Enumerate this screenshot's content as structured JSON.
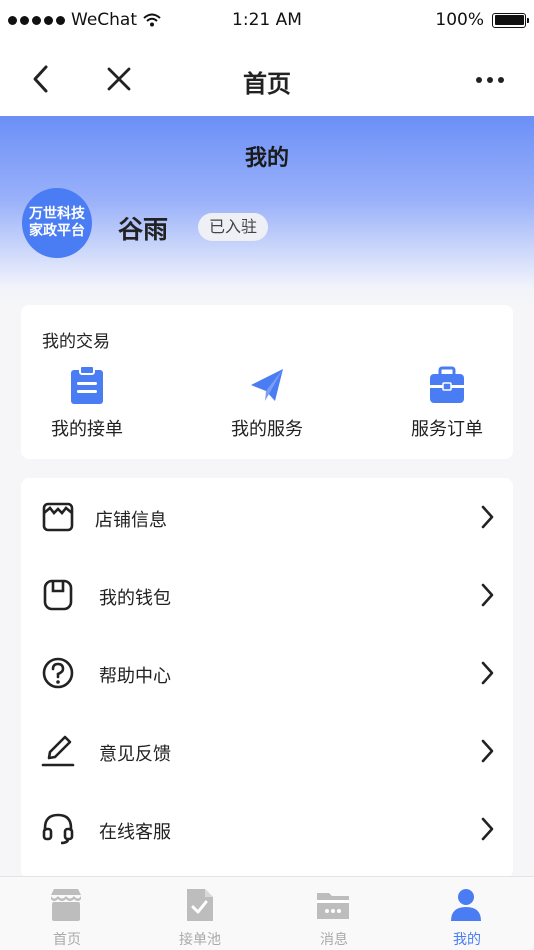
{
  "status_bar": {
    "carrier": "WeChat",
    "time": "1:21 AM",
    "battery": "100%"
  },
  "nav": {
    "title": "首页"
  },
  "hero": {
    "title": "我的",
    "avatar_line1": "万世科技",
    "avatar_line2": "家政平台",
    "user_name": "谷雨",
    "badge": "已入驻"
  },
  "trade": {
    "title": "我的交易",
    "items": [
      {
        "label": "我的接单",
        "icon": "clipboard-icon"
      },
      {
        "label": "我的服务",
        "icon": "paper-plane-icon"
      },
      {
        "label": "服务订单",
        "icon": "briefcase-icon"
      }
    ]
  },
  "menu": {
    "items": [
      {
        "label": "店铺信息",
        "icon": "store-icon"
      },
      {
        "label": "我的钱包",
        "icon": "wallet-icon"
      },
      {
        "label": "帮助中心",
        "icon": "help-icon"
      },
      {
        "label": "意见反馈",
        "icon": "edit-icon"
      },
      {
        "label": "在线客服",
        "icon": "headset-icon"
      }
    ]
  },
  "tabs": [
    {
      "label": "首页",
      "icon": "shop-icon"
    },
    {
      "label": "接单池",
      "icon": "document-check-icon"
    },
    {
      "label": "消息",
      "icon": "folder-icon"
    },
    {
      "label": "我的",
      "icon": "user-icon",
      "active": true
    }
  ],
  "colors": {
    "accent": "#4a7cf3",
    "inactive": "#aaaaaa"
  }
}
